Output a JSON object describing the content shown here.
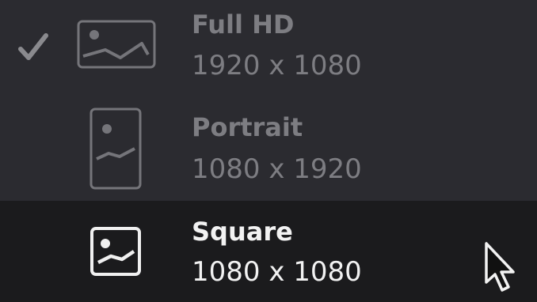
{
  "menu": {
    "items": [
      {
        "title": "Full HD",
        "resolution": "1920 x 1080",
        "icon": "landscape-image-icon",
        "checked": true
      },
      {
        "title": "Portrait",
        "resolution": "1080 x 1920",
        "icon": "portrait-image-icon",
        "checked": false
      },
      {
        "title": "Square",
        "resolution": "1080 x 1080",
        "icon": "square-image-icon",
        "checked": false,
        "highlighted": true
      }
    ]
  },
  "colors": {
    "background": "#2b2b30",
    "highlight_background": "#1b1b1d",
    "dim_text": "#7d7d82",
    "active_text": "#f2f2f2"
  }
}
